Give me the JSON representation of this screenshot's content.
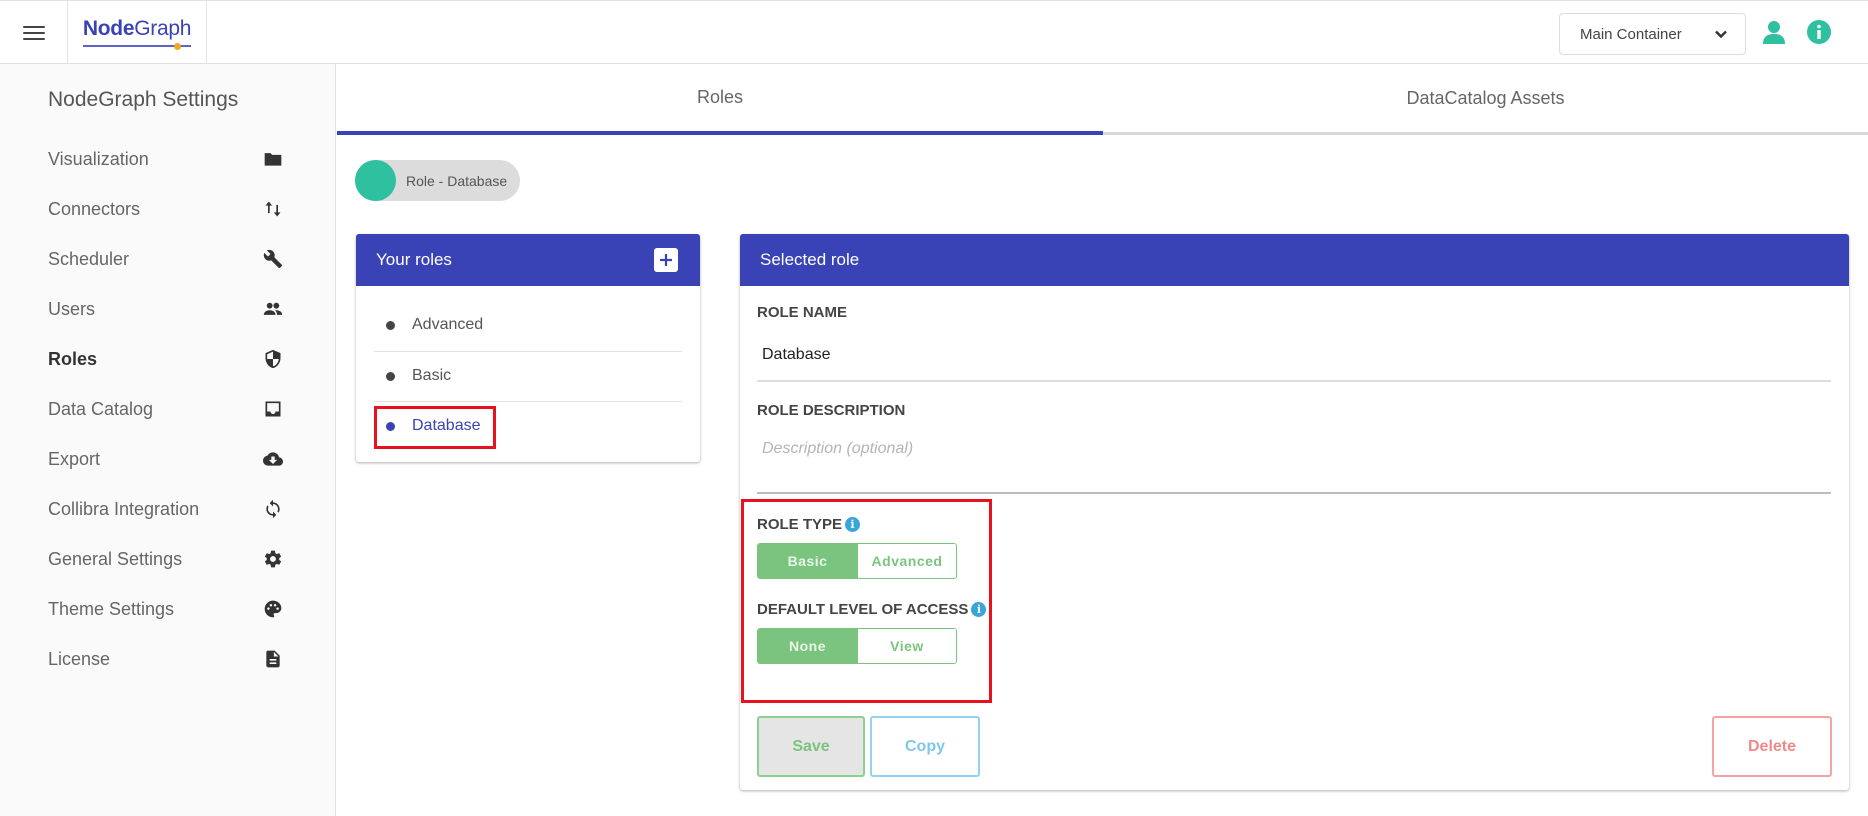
{
  "topbar": {
    "menu_icon": "hamburger-icon",
    "logo": {
      "bold": "Node",
      "regular": "Graph"
    },
    "container_select": {
      "value": "Main Container",
      "icon": "chevron-down-icon"
    },
    "user_icon": "user-icon",
    "info_icon": "info-icon",
    "accent_color": "#2fc0a0"
  },
  "sidebar": {
    "title": "NodeGraph Settings",
    "items": [
      {
        "label": "Visualization",
        "icon": "folder-icon",
        "active": false
      },
      {
        "label": "Connectors",
        "icon": "swap-vertical-icon",
        "active": false
      },
      {
        "label": "Scheduler",
        "icon": "wrench-icon",
        "active": false
      },
      {
        "label": "Users",
        "icon": "people-icon",
        "active": false
      },
      {
        "label": "Roles",
        "icon": "shield-icon",
        "active": true
      },
      {
        "label": "Data Catalog",
        "icon": "inbox-icon",
        "active": false
      },
      {
        "label": "Export",
        "icon": "cloud-download-icon",
        "active": false
      },
      {
        "label": "Collibra Integration",
        "icon": "sync-icon",
        "active": false
      },
      {
        "label": "General Settings",
        "icon": "gear-icon",
        "active": false
      },
      {
        "label": "Theme Settings",
        "icon": "palette-icon",
        "active": false
      },
      {
        "label": "License",
        "icon": "document-icon",
        "active": false
      }
    ]
  },
  "tabs": [
    {
      "label": "Roles",
      "active": true
    },
    {
      "label": "DataCatalog Assets",
      "active": false
    }
  ],
  "chip": {
    "label": "Role - Database"
  },
  "roles_panel": {
    "title": "Your roles",
    "add_icon": "plus-icon",
    "roles": [
      {
        "name": "Advanced",
        "selected": false
      },
      {
        "name": "Basic",
        "selected": false
      },
      {
        "name": "Database",
        "selected": true
      }
    ]
  },
  "selected_role": {
    "title": "Selected role",
    "role_name_label": "ROLE NAME",
    "role_name_value": "Database",
    "role_description_label": "ROLE DESCRIPTION",
    "role_description_placeholder": "Description (optional)",
    "role_type_label": "ROLE TYPE",
    "role_type_options": [
      "Basic",
      "Advanced"
    ],
    "role_type_selected": "Basic",
    "default_access_label": "DEFAULT LEVEL OF ACCESS",
    "default_access_options": [
      "None",
      "View"
    ],
    "default_access_selected": "None",
    "buttons": {
      "save": "Save",
      "copy": "Copy",
      "delete": "Delete"
    }
  },
  "colors": {
    "primary": "#3a43b5",
    "success": "#7bc47f",
    "info": "#3aa5d9",
    "danger": "#f08a8a",
    "highlight": "#e8121e"
  }
}
